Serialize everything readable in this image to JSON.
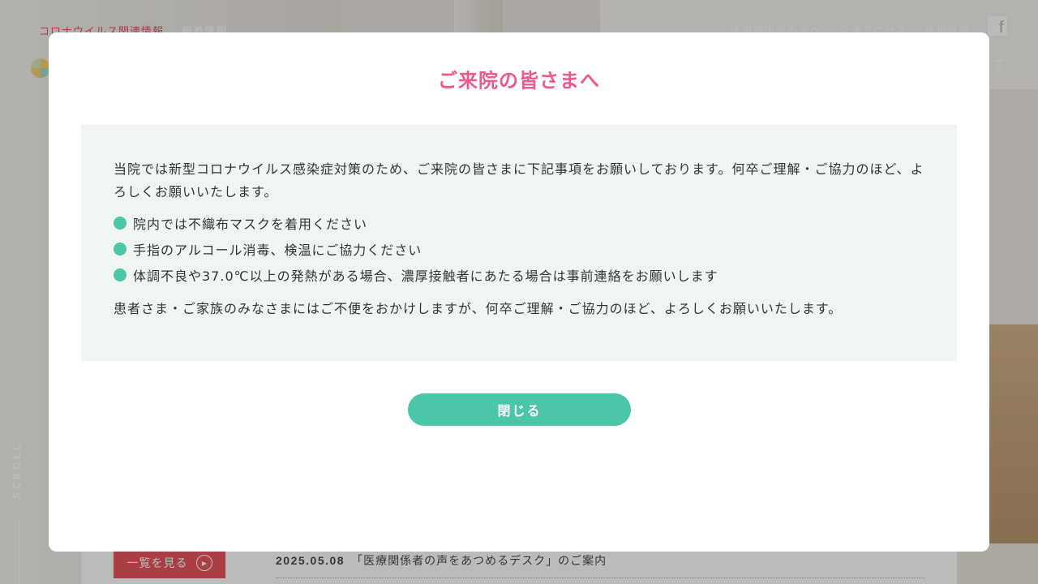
{
  "header": {
    "covid_link": "コロナウイルス関連情報",
    "news_link": "新着情報",
    "nav_right": [
      "医療関係者の方へ",
      "交通アクセス",
      "採用情報"
    ],
    "facebook_icon": "facebook-icon",
    "about_partial": "いて"
  },
  "side": {
    "scroll_label": "SCROLL"
  },
  "news": {
    "more_label": "一覧を見る",
    "more_icon": "play-circle-icon",
    "items": [
      {
        "date": "2025.05.08",
        "title": "「医療関係者の声をあつめるデスク」のご案内"
      }
    ]
  },
  "modal": {
    "title": "ご来院の皆さまへ",
    "intro": "当院では新型コロナウイルス感染症対策のため、ご来院の皆さまに下記事項をお願いしております。何卒ご理解・ご協力のほど、よろしくお願いいたします。",
    "bullets": [
      "院内では不織布マスクを着用ください",
      "手指のアルコール消毒、検温にご協力ください",
      "体調不良や37.0℃以上の発熱がある場合、濃厚接触者にあたる場合は事前連絡をお願いします"
    ],
    "closing": "患者さま・ご家族のみなさまにはご不便をおかけしますが、何卒ご理解・ご協力のほど、よろしくお願いいたします。",
    "close_label": "閉じる"
  },
  "colors": {
    "accent_pink": "#ec5a8c",
    "accent_green": "#4bc6a8",
    "notice_bg": "#eff6f1",
    "covid_red": "#e6404a"
  }
}
